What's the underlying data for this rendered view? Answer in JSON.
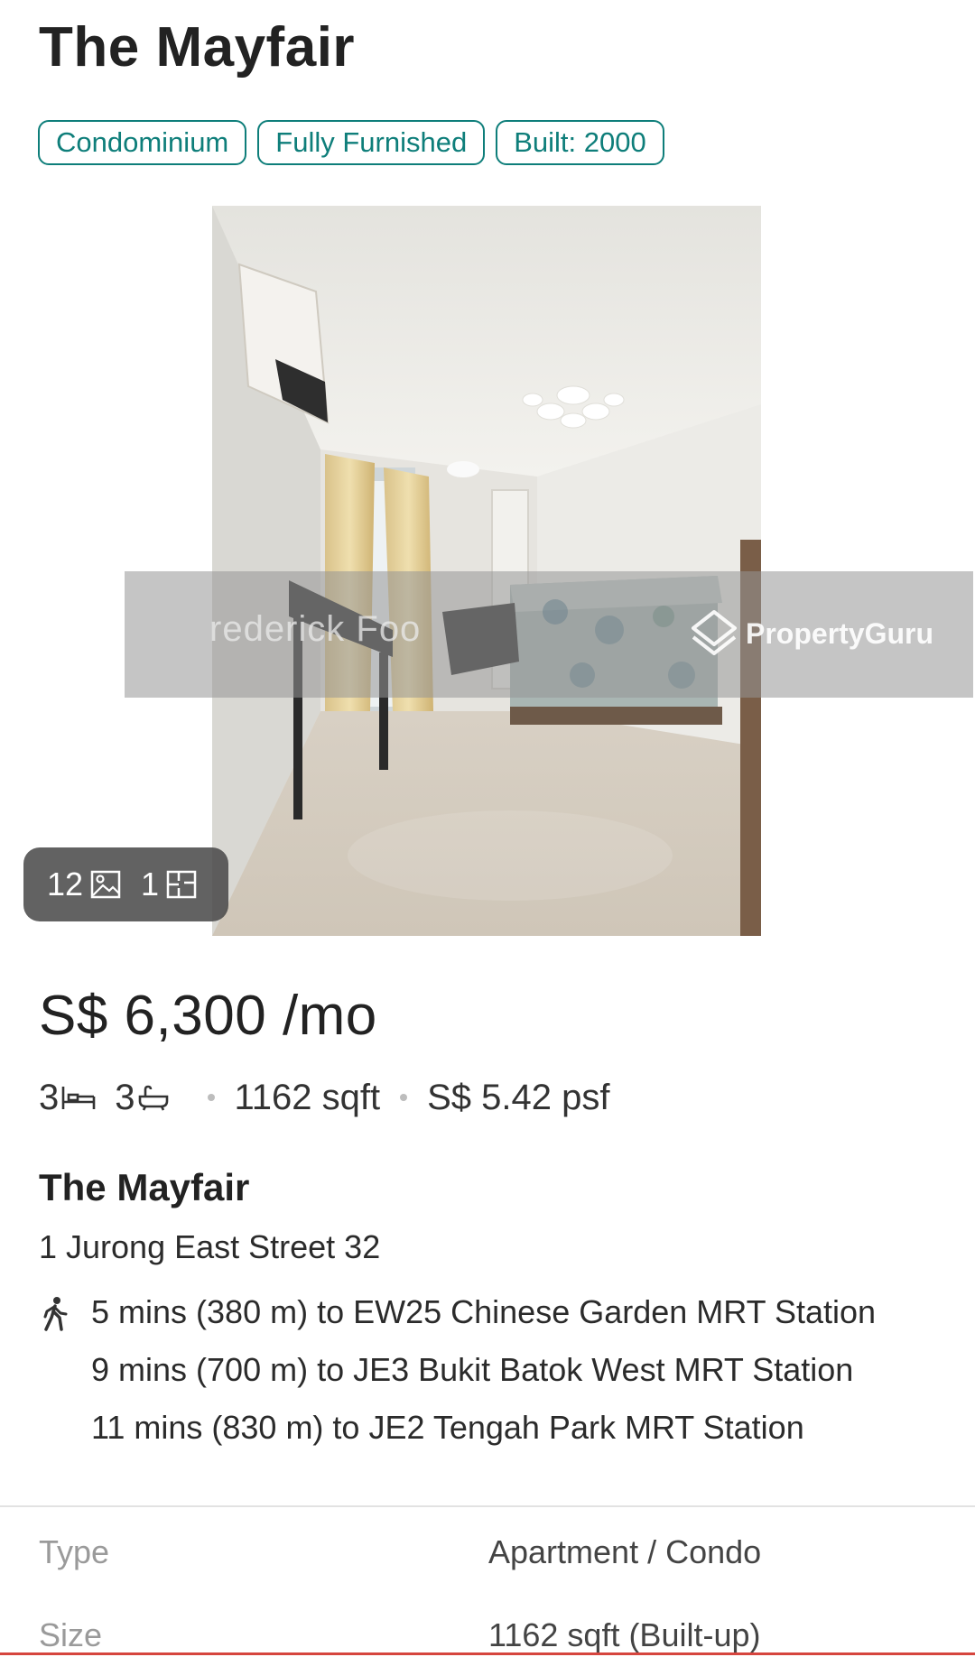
{
  "listing": {
    "title": "The Mayfair",
    "tags": [
      "Condominium",
      "Fully Furnished",
      "Built: 2000"
    ],
    "photo": {
      "watermark_agent": "rederick Foo",
      "watermark_brand": "PropertyGuru",
      "photo_count": "12",
      "floorplan_count": "1"
    },
    "price": "S$ 6,300 /mo",
    "beds": "3",
    "baths": "3",
    "size": "1162 sqft",
    "psf": "S$ 5.42 psf",
    "project_name": "The Mayfair",
    "address": "1 Jurong East Street 32",
    "mrt": [
      "5 mins (380 m) to EW25 Chinese Garden MRT Station",
      "9 mins (700 m) to JE3 Bukit Batok West MRT Station",
      "11 mins (830 m) to JE2 Tengah Park MRT Station"
    ]
  },
  "details": [
    {
      "label": "Type",
      "value": "Apartment / Condo"
    },
    {
      "label": "Size",
      "value": "1162 sqft (Built-up)"
    }
  ],
  "icons": {
    "photo": "image-icon",
    "floorplan": "floorplan-icon",
    "bed": "bed-icon",
    "bath": "bathtub-icon",
    "walk": "walking-person-icon",
    "brand": "propertyguru-logo"
  },
  "colors": {
    "accent": "#0e7e7a",
    "bottom_bar": "#d6453e"
  }
}
